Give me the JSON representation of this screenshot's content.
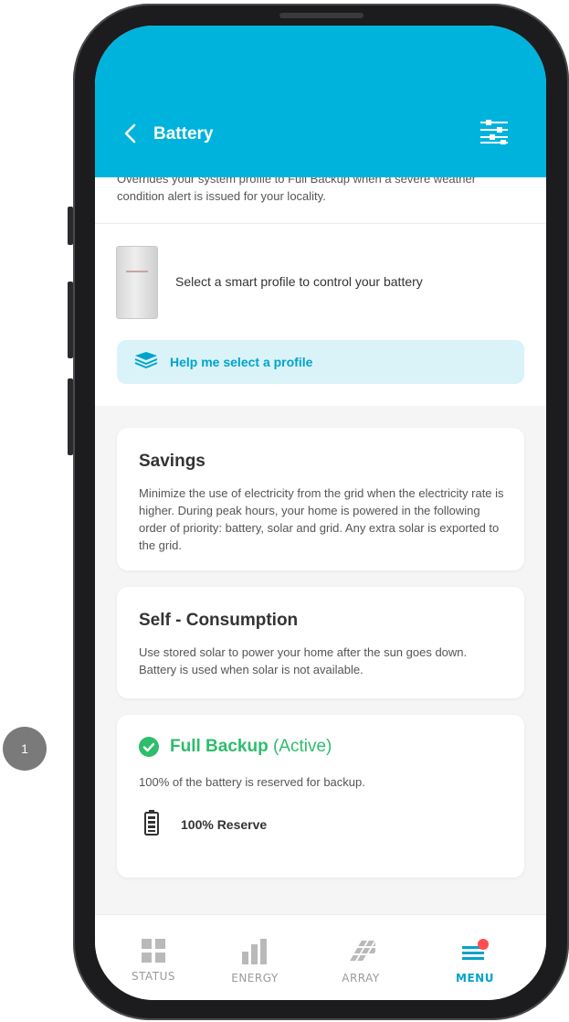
{
  "step_badge": "1",
  "header": {
    "title": "Battery"
  },
  "weather": {
    "description": "Overrides your system profile to Full Backup when a severe weather condition alert is issued for your locality."
  },
  "smart_profile": {
    "text": "Select a smart profile to control your battery",
    "help_label": "Help me select a profile"
  },
  "profiles": [
    {
      "title": "Savings",
      "description": "Minimize the use of electricity from the grid when the electricity rate is higher. During peak hours, your home is powered in the following order of priority: battery, solar and grid. Any extra solar is exported to the grid."
    },
    {
      "title": "Self - Consumption",
      "description": "Use stored solar to power your home after the sun goes down. Battery is used when solar is not available."
    },
    {
      "title": "Full Backup",
      "status": "(Active)",
      "description": "100% of the battery is reserved for backup.",
      "reserve_label": "100% Reserve"
    }
  ],
  "tabbar": {
    "items": [
      {
        "label": "STATUS",
        "icon": "grid-icon"
      },
      {
        "label": "ENERGY",
        "icon": "bar-chart-icon"
      },
      {
        "label": "ARRAY",
        "icon": "solar-array-icon"
      },
      {
        "label": "MENU",
        "icon": "menu-icon",
        "active": true
      }
    ]
  },
  "colors": {
    "header": "#00b3dc",
    "accent": "#00a3cc",
    "active_green": "#2ebd6b",
    "notification": "#ff4d4d"
  }
}
